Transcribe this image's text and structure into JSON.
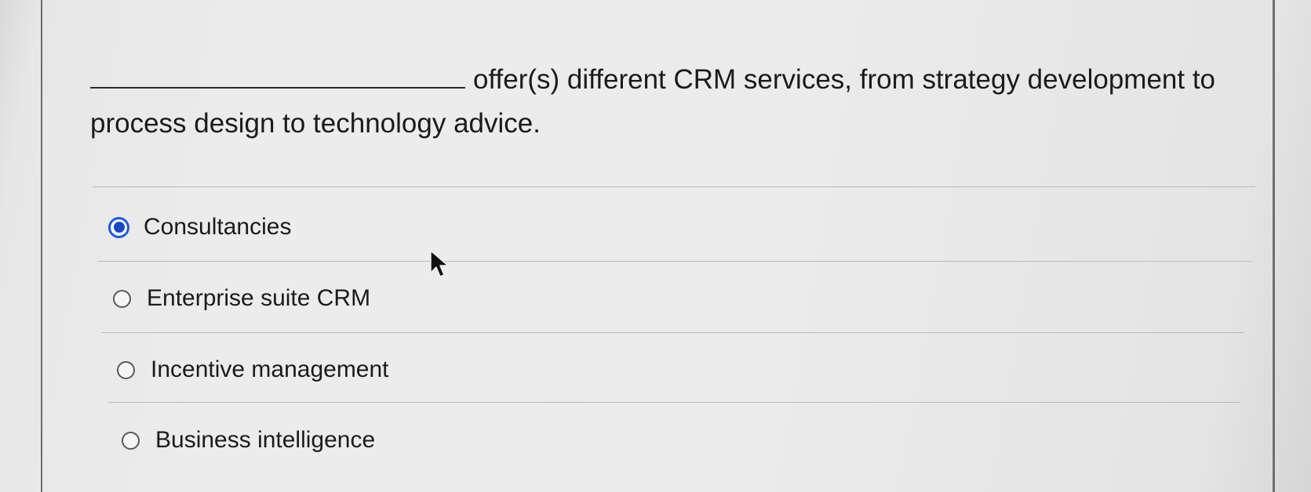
{
  "question": {
    "text_line1": "offer(s) different CRM services, from strategy development to",
    "text_line2": "process design to technology advice."
  },
  "options": [
    {
      "label": "Consultancies",
      "selected": true
    },
    {
      "label": "Enterprise suite CRM",
      "selected": false
    },
    {
      "label": "Incentive management",
      "selected": false
    },
    {
      "label": "Business intelligence",
      "selected": false
    }
  ],
  "colors": {
    "radio_selected": "#1f57e0",
    "page_background": "#ebebeb"
  },
  "icons": {
    "pointer": "mouse-pointer-icon"
  }
}
